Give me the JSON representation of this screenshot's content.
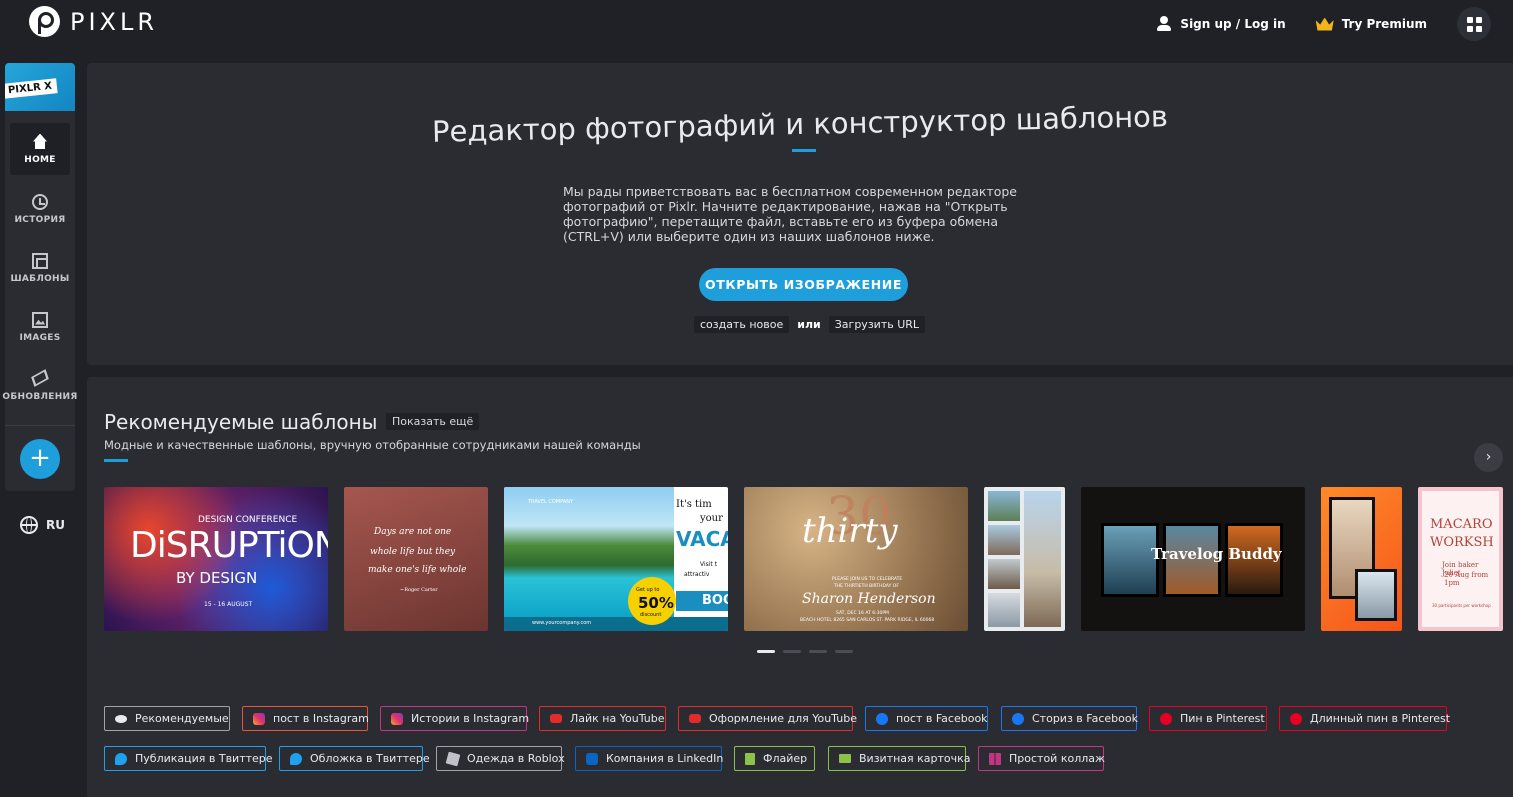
{
  "header": {
    "logo_text": "PIXLR",
    "signup_label": "Sign up / Log in",
    "premium_label": "Try Premium",
    "icons": [
      "user-icon",
      "crown-icon",
      "apps-grid-icon"
    ]
  },
  "sidebar": {
    "pixlrx_label": "PIXLR X",
    "items": [
      {
        "label": "HOME",
        "icon": "home-icon"
      },
      {
        "label": "ИСТОРИЯ",
        "icon": "history-icon"
      },
      {
        "label": "ШАБЛОНЫ",
        "icon": "templates-icon"
      },
      {
        "label": "IMAGES",
        "icon": "image-icon"
      },
      {
        "label": "ОБНОВЛЕНИЯ",
        "icon": "updates-icon"
      }
    ],
    "plus_label": "+",
    "language": "RU"
  },
  "hero": {
    "title": "Редактор фотографий и конструктор шаблонов",
    "description": "Мы рады приветствовать вас в бесплатном современном редакторе фотографий от Pixlr. Начните редактирование, нажав на \"Открыть фотографию\", перетащите файл, вставьте его из буфера обмена (CTRL+V) или выберите один из наших шаблонов ниже.",
    "open_button": "ОТКРЫТЬ ИЗОБРАЖЕНИЕ",
    "create_new": "создать новое",
    "or": "или",
    "load_url": "Загрузить URL"
  },
  "templates": {
    "title": "Рекомендуемые шаблоны",
    "show_more": "Показать ещё",
    "subtitle": "Модные и качественные шаблоны, вручную отобранные сотрудниками нашей команды",
    "next_icon": "chevron-right-icon",
    "cards": [
      {
        "name": "disruption",
        "texts": [
          "DESIGN CONFERENCE",
          "DiSRUPTiON",
          "BY DESIGN",
          "15 - 16 AUGUST"
        ]
      },
      {
        "name": "quote",
        "texts": [
          "Days are not one",
          "whole life but they",
          "make one's life whole",
          "~Roger Carter"
        ]
      },
      {
        "name": "vacation",
        "texts": [
          "TRAVEL COMPANY",
          "It's tim",
          "your",
          "VACA",
          "Visit t",
          "attractiv",
          "Get up to",
          "50%",
          "discount",
          "www.yourcompany.com",
          "BOO"
        ]
      },
      {
        "name": "thirty",
        "texts": [
          "30",
          "thirty",
          "PLEASE JOIN US TO CELEBRATE",
          "THE THIRTIETH BIRTHDAY OF",
          "Sharon Henderson",
          "SAT, DEC 16 AT 6:30PM",
          "BEACH HOTEL 8265 SAN CARLOS ST. PARK RIDGE, IL 60068"
        ]
      },
      {
        "name": "collage",
        "texts": []
      },
      {
        "name": "travelog",
        "texts": [
          "Travelog Buddy"
        ]
      },
      {
        "name": "portrait",
        "texts": []
      },
      {
        "name": "macaron",
        "texts": [
          "MACARO",
          "WORKSH",
          "Join baker Juliet",
          "20 Aug from 1pm",
          "30 participants per workshop"
        ]
      }
    ],
    "pager_count": 4,
    "pager_active": 0
  },
  "tags": [
    {
      "label": "Рекомендуемые",
      "icon": "eye-icon",
      "color": "#9fa3ab"
    },
    {
      "label": "пост в Instagram",
      "icon": "instagram-icon",
      "color": "#e9533a"
    },
    {
      "label": "Истории в Instagram",
      "icon": "instagram-icon",
      "color": "#c13584"
    },
    {
      "label": "Лайк на YouTube",
      "icon": "youtube-icon",
      "color": "#e32b2b"
    },
    {
      "label": "Оформление для YouTube",
      "icon": "youtube-icon",
      "color": "#e32b2b"
    },
    {
      "label": "пост в Facebook",
      "icon": "facebook-icon",
      "color": "#1877f2"
    },
    {
      "label": "Сториз в Facebook",
      "icon": "facebook-icon",
      "color": "#1877f2"
    },
    {
      "label": "Пин в Pinterest",
      "icon": "pinterest-icon",
      "color": "#e60023"
    },
    {
      "label": "Длинный пин в Pinterest",
      "icon": "pinterest-icon",
      "color": "#e60023"
    },
    {
      "label": "Публикация в Твиттере",
      "icon": "twitter-icon",
      "color": "#1da1f2"
    },
    {
      "label": "Обложка в Твиттере",
      "icon": "twitter-icon",
      "color": "#1da1f2"
    },
    {
      "label": "Одежда в Roblox",
      "icon": "roblox-icon",
      "color": "#9fa3ab"
    },
    {
      "label": "Компания в LinkedIn",
      "icon": "linkedin-icon",
      "color": "#0a66c2"
    },
    {
      "label": "Флайер",
      "icon": "flyer-icon",
      "color": "#8bc34a"
    },
    {
      "label": "Визитная карточка",
      "icon": "business-card-icon",
      "color": "#8bc34a"
    },
    {
      "label": "Простой коллаж",
      "icon": "collage-icon",
      "color": "#c13584"
    }
  ],
  "colors": {
    "accent": "#1e9fdc",
    "background": "#1f2126",
    "panel": "#2a2c31"
  }
}
